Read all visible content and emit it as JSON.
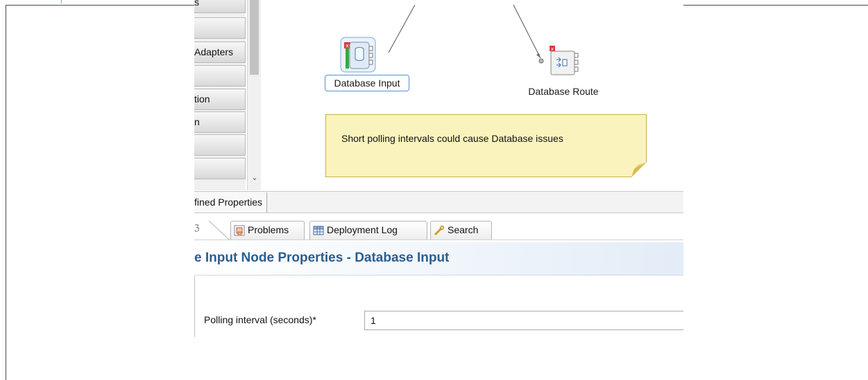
{
  "palette": {
    "items": [
      "s",
      "",
      "Adapters",
      "",
      "tion",
      "n",
      "",
      ""
    ]
  },
  "canvas": {
    "nodes": [
      {
        "label": "Database Input",
        "icon": "database-input-node-icon"
      },
      {
        "label": "Database Route",
        "icon": "database-route-node-icon"
      }
    ],
    "note_text": "Short polling intervals could cause Database issues"
  },
  "properties_strip": {
    "tab_label": "fined Properties"
  },
  "view_tabs": {
    "close_glyph": "ℨ",
    "problems": "Problems",
    "deployment_log": "Deployment Log",
    "search": "Search"
  },
  "properties": {
    "title": "e Input Node Properties - Database Input",
    "polling_label": "Polling interval (seconds)*",
    "polling_value": "1"
  },
  "colors": {
    "title": "#2b5d90",
    "note_bg": "#fbf3bd",
    "selection_border": "#5b8fd6"
  }
}
